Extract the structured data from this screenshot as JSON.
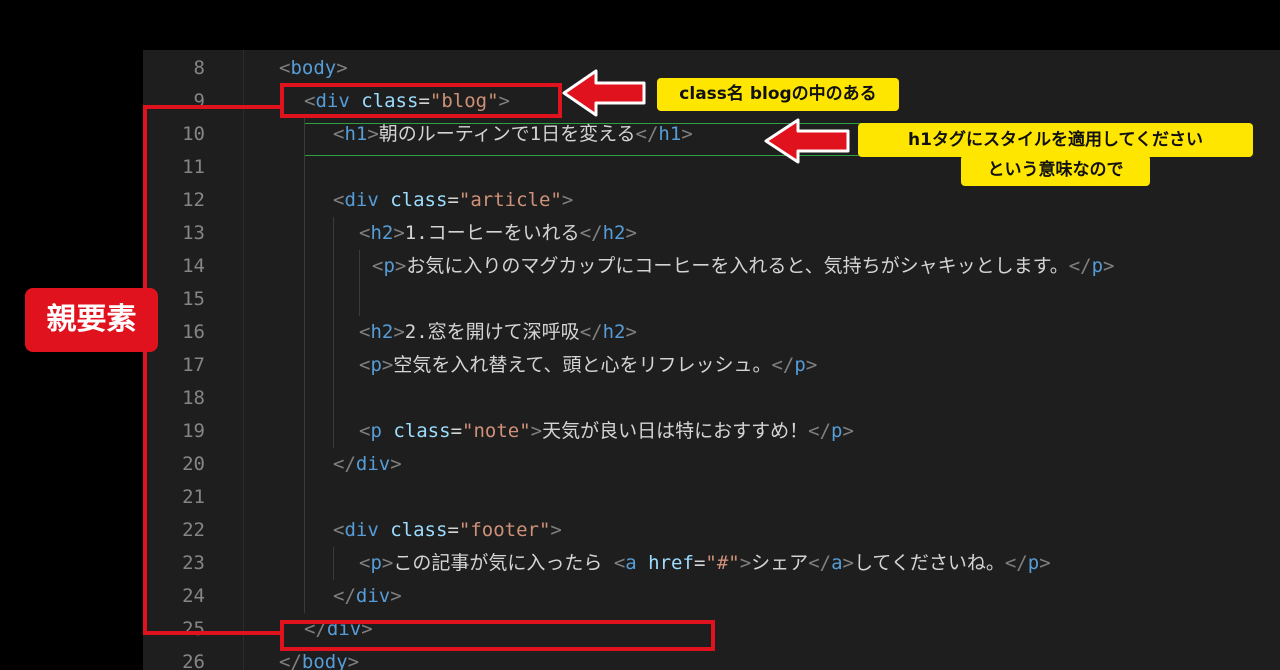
{
  "editor": {
    "lines": [
      {
        "n": "8"
      },
      {
        "n": "9"
      },
      {
        "n": "10"
      },
      {
        "n": "11"
      },
      {
        "n": "12"
      },
      {
        "n": "13"
      },
      {
        "n": "14"
      },
      {
        "n": "15"
      },
      {
        "n": "16"
      },
      {
        "n": "17"
      },
      {
        "n": "18"
      },
      {
        "n": "19"
      },
      {
        "n": "20"
      },
      {
        "n": "21"
      },
      {
        "n": "22"
      },
      {
        "n": "23"
      },
      {
        "n": "24"
      },
      {
        "n": "25"
      },
      {
        "n": "26"
      }
    ],
    "code": {
      "l8": {
        "open": "<",
        "tag": "body",
        "close": ">"
      },
      "l9": {
        "open": "<",
        "tag": "div",
        "attr": "class",
        "eq": "=",
        "val": "\"blog\"",
        "close": ">"
      },
      "l10": {
        "open": "<",
        "tag": "h1",
        "gt": ">",
        "text": "朝のルーティンで1日を変える",
        "end_open": "</",
        "end_tag": "h1",
        "close": ">"
      },
      "l12": {
        "open": "<",
        "tag": "div",
        "attr": "class",
        "eq": "=",
        "val": "\"article\"",
        "close": ">"
      },
      "l13": {
        "open": "<",
        "tag": "h2",
        "gt": ">",
        "text": "1.コーヒーをいれる",
        "end_open": "</",
        "end_tag": "h2",
        "close": ">"
      },
      "l14": {
        "open": "<",
        "tag": "p",
        "gt": ">",
        "text": "お気に入りのマグカップにコーヒーを入れると、気持ちがシャキッとします。",
        "end_open": "</",
        "end_tag": "p",
        "close": ">"
      },
      "l16": {
        "open": "<",
        "tag": "h2",
        "gt": ">",
        "text": "2.窓を開けて深呼吸",
        "end_open": "</",
        "end_tag": "h2",
        "close": ">"
      },
      "l17": {
        "open": "<",
        "tag": "p",
        "gt": ">",
        "text": "空気を入れ替えて、頭と心をリフレッシュ。",
        "end_open": "</",
        "end_tag": "p",
        "close": ">"
      },
      "l19": {
        "open": "<",
        "tag": "p",
        "attr": "class",
        "eq": "=",
        "val": "\"note\"",
        "gt": ">",
        "text": "天気が良い日は特におすすめ！",
        "end_open": "</",
        "end_tag": "p",
        "close": ">"
      },
      "l20": {
        "open": "</",
        "tag": "div",
        "close": ">"
      },
      "l22": {
        "open": "<",
        "tag": "div",
        "attr": "class",
        "eq": "=",
        "val": "\"footer\"",
        "close": ">"
      },
      "l23": {
        "open": "<",
        "tag": "p",
        "gt": ">",
        "text1": "この記事が気に入ったら ",
        "a_open": "<",
        "a_tag": "a",
        "a_attr": "href",
        "eq": "=",
        "a_val": "\"#\"",
        "a_gt": ">",
        "a_text": "シェア",
        "a_end_open": "</",
        "a_end_tag": "a",
        "a_close": ">",
        "text2": "してくださいね。",
        "end_open": "</",
        "end_tag": "p",
        "close": ">"
      },
      "l24": {
        "open": "</",
        "tag": "div",
        "close": ">"
      },
      "l25": {
        "open": "</",
        "tag": "div",
        "close": ">"
      },
      "l26": {
        "open": "</",
        "tag": "body",
        "close": ">"
      }
    }
  },
  "annotations": {
    "blog_label": "class名 blogの中のある",
    "h1_label_line1": "h1タグにスタイルを適用してください",
    "h1_label_line2": "という意味なので",
    "parent_label": "親要素"
  },
  "colors": {
    "accent_red": "#e0121d",
    "label_yellow": "#ffe600",
    "editor_bg": "#1e1e1e",
    "highlight_green": "#2ea043"
  }
}
